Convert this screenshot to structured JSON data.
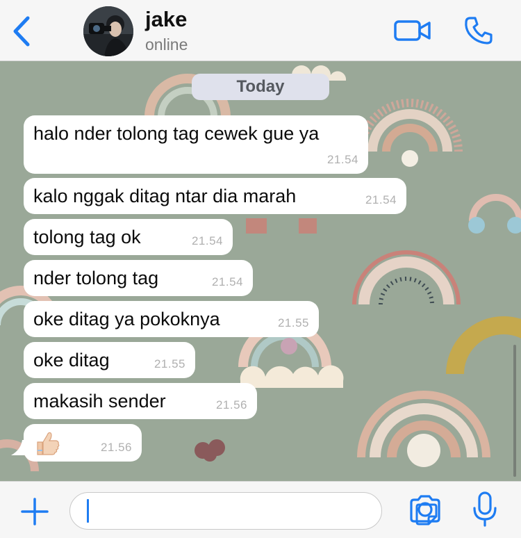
{
  "header": {
    "contact_name": "jake",
    "contact_status": "online",
    "back_icon": "chevron-left-icon",
    "video_icon": "video-camera-icon",
    "call_icon": "phone-icon"
  },
  "chat": {
    "date_label": "Today",
    "messages": [
      {
        "text": "halo nder tolong tag cewek gue ya",
        "time": "21.54"
      },
      {
        "text": "kalo nggak ditag ntar dia marah",
        "time": "21.54"
      },
      {
        "text": "tolong tag ok",
        "time": "21.54"
      },
      {
        "text": "nder tolong tag",
        "time": "21.54"
      },
      {
        "text": "oke ditag ya pokoknya",
        "time": "21.55"
      },
      {
        "text": "oke ditag",
        "time": "21.55"
      },
      {
        "text": "makasih sender",
        "time": "21.56"
      },
      {
        "text": "",
        "emoji": "thumbs-up-icon",
        "time": "21.56"
      }
    ]
  },
  "input_bar": {
    "plus_icon": "plus-icon",
    "text_value": "",
    "sticker_icon": "sticker-icon",
    "camera_icon": "camera-icon",
    "mic_icon": "microphone-icon"
  },
  "colors": {
    "accent": "#1e7cf2",
    "wallpaper": "#9aa898",
    "bubble": "#ffffff",
    "date_pill": "#dfe1ec"
  }
}
